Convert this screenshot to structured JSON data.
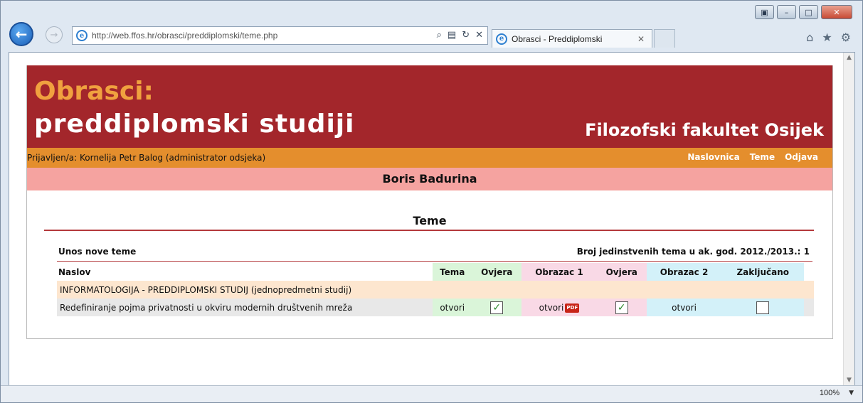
{
  "browser": {
    "url": "http://web.ffos.hr/obrasci/preddiplomski/teme.php",
    "tab_title": "Obrasci - Preddiplomski",
    "zoom": "100%",
    "back_glyph": "←",
    "forward_glyph": "→",
    "min_glyph": "–",
    "max_glyph": "□",
    "close_glyph": "✕",
    "restore_glyph": "▣"
  },
  "header": {
    "line1": "Obrasci:",
    "line2": "preddiplomski studiji",
    "faculty": "Filozofski fakultet Osijek",
    "colors": {
      "banner": "#a3262b",
      "accent": "#f0a13f",
      "userbar": "#e48e2d",
      "namebar": "#f5a3a0"
    }
  },
  "userbar": {
    "logged_in": "Prijavljen/a: Kornelija Petr Balog (administrator odsjeka)",
    "links": [
      "Naslovnica",
      "Teme",
      "Odjava"
    ]
  },
  "person": "Boris Badurina",
  "section": {
    "title": "Teme",
    "new_topic": "Unos nove teme",
    "count_label": "Broj jedinstvenih tema u ak. god. 2012./2013.: 1"
  },
  "table": {
    "headers": [
      "Naslov",
      "Tema",
      "Ovjera",
      "Obrazac 1",
      "Ovjera",
      "Obrazac 2",
      "Zaključano"
    ],
    "group": "INFORMATOLOGIJA - PREDDIPLOMSKI STUDIJ (jednopredmetni studij)",
    "rows": [
      {
        "title": "Redefiniranje pojma privatnosti u okviru modernih društvenih mreža",
        "tema": "otvori",
        "ovjera1_checked": true,
        "obrazac1": "otvori",
        "pdf_label": "PDF",
        "ovjera2_checked": true,
        "obrazac2": "otvori",
        "zakljucano_checked": false,
        "check_glyph": "✓"
      }
    ]
  }
}
